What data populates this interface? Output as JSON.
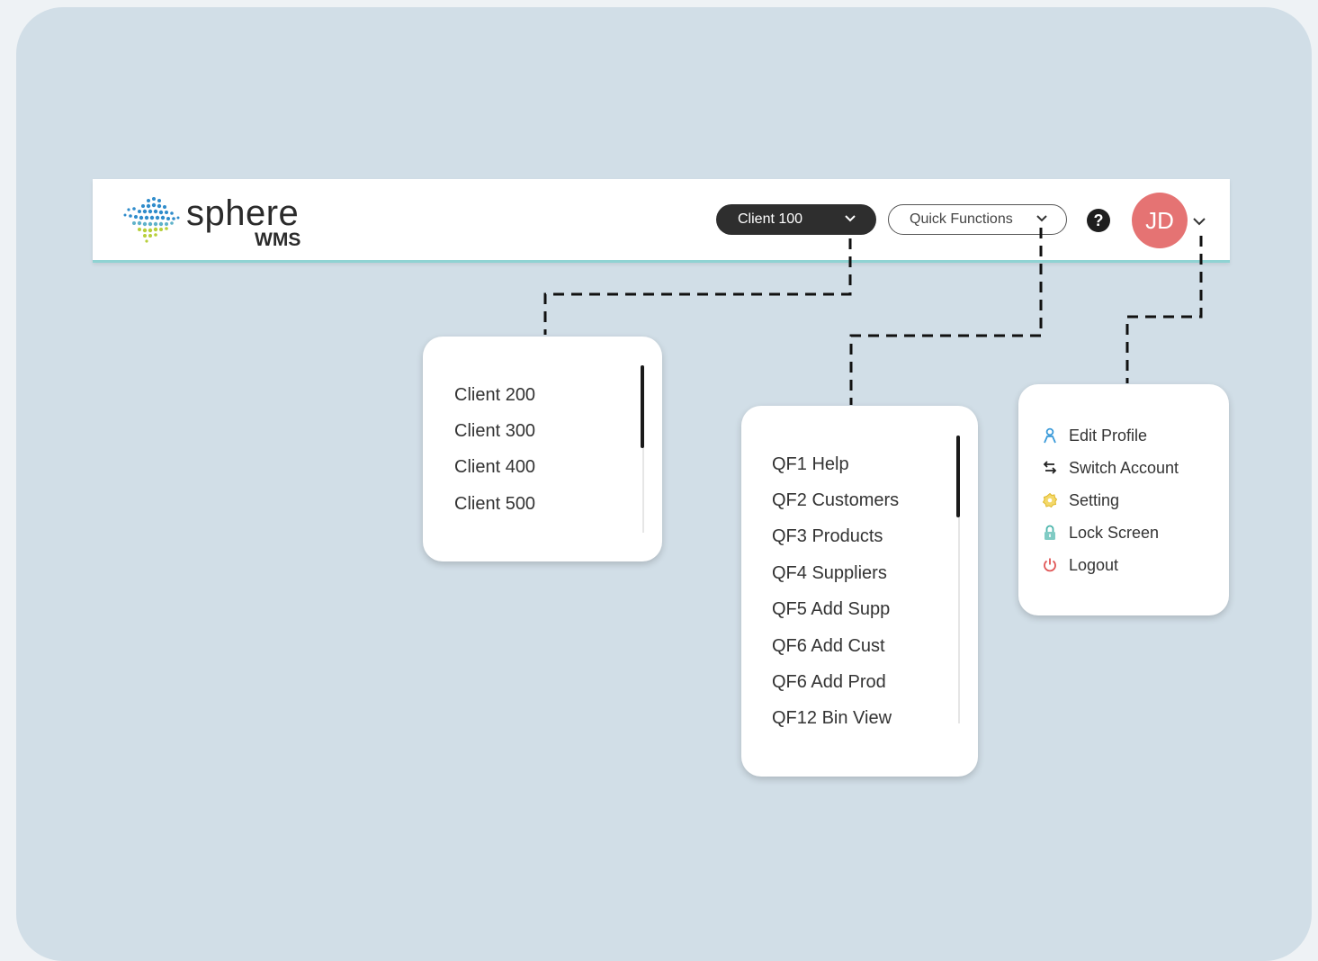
{
  "brand": {
    "name": "sphere",
    "sub": "WMS"
  },
  "header": {
    "client_selector": "Client 100",
    "quick_functions": "Quick Functions",
    "help": "?",
    "avatar_initials": "JD"
  },
  "client_menu": {
    "items": [
      "Client 200",
      "Client 300",
      "Client 400",
      "Client 500"
    ]
  },
  "quick_menu": {
    "items": [
      "QF1 Help",
      "QF2 Customers",
      "QF3 Products",
      "QF4 Suppliers",
      "QF5 Add Supp",
      "QF6 Add Cust",
      "QF6 Add Prod",
      "QF12 Bin View"
    ]
  },
  "account_menu": {
    "items": [
      {
        "label": "Edit Profile",
        "icon": "user-icon",
        "color": "#3a9ad9"
      },
      {
        "label": "Switch Account",
        "icon": "switch-arrows-icon",
        "color": "#222222"
      },
      {
        "label": "Setting",
        "icon": "gear-icon",
        "color": "#e8c33a"
      },
      {
        "label": "Lock Screen",
        "icon": "lock-icon",
        "color": "#4db6ac"
      },
      {
        "label": "Logout",
        "icon": "power-icon",
        "color": "#e05555"
      }
    ]
  },
  "colors": {
    "background": "#d1dee7",
    "avatar": "#e57373",
    "topbar_accent": "#8fd3d3",
    "dark_button": "#2e2e2e"
  }
}
